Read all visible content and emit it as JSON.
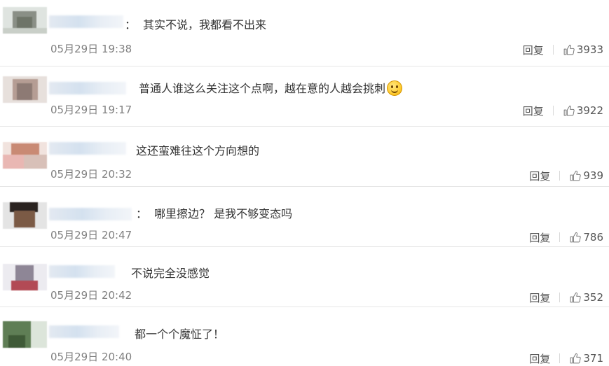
{
  "comments": [
    {
      "text": "其实不说，我都看不出来",
      "has_colon": true,
      "has_emoji": false,
      "time": "05月29日 19:38",
      "reply_label": "回复",
      "likes": "3933"
    },
    {
      "text": "普通人谁这么关注这个点啊，越在意的人越会挑刺",
      "has_colon": false,
      "has_emoji": true,
      "emoji": "smiley-face",
      "time": "05月29日 19:17",
      "reply_label": "回复",
      "likes": "3922"
    },
    {
      "text": "这还蛮难往这个方向想的",
      "has_colon": false,
      "has_emoji": false,
      "time": "05月29日 20:32",
      "reply_label": "回复",
      "likes": "939"
    },
    {
      "text": "哪里擦边？ 是我不够变态吗",
      "has_colon": true,
      "has_emoji": false,
      "time": "05月29日 20:47",
      "reply_label": "回复",
      "likes": "786"
    },
    {
      "text": "不说完全没感觉",
      "has_colon": false,
      "has_emoji": false,
      "time": "05月29日 20:42",
      "reply_label": "回复",
      "likes": "352"
    },
    {
      "text": "都一个个魔怔了！",
      "has_colon": false,
      "has_emoji": false,
      "time": "05月29日 20:40",
      "reply_label": "回复",
      "likes": "371"
    }
  ],
  "colon": "：",
  "icons": {
    "like": "thumbs-up-icon",
    "avatar": "blurred-avatar"
  },
  "colors": {
    "text": "#333333",
    "time": "#808080",
    "divider": "#e6e6e6"
  }
}
